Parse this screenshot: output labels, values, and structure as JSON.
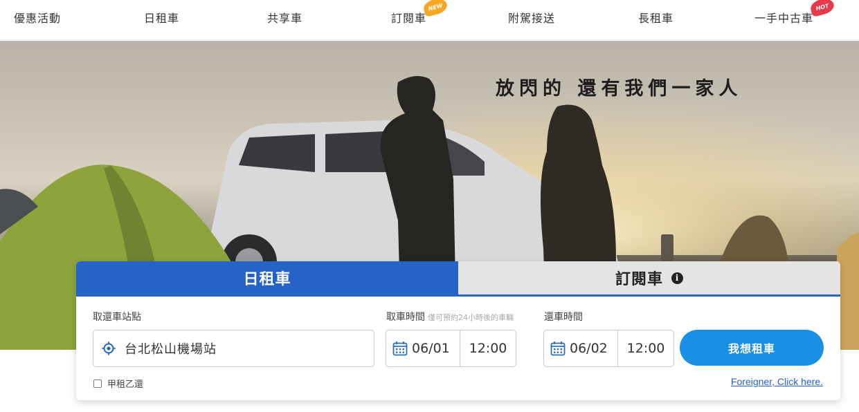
{
  "nav": {
    "items": [
      {
        "label": "優惠活動"
      },
      {
        "label": "日租車"
      },
      {
        "label": "共享車"
      },
      {
        "label": "訂閱車",
        "badge": "NEW"
      },
      {
        "label": "附駕接送"
      },
      {
        "label": "長租車"
      },
      {
        "label": "一手中古車",
        "badge": "HOT"
      }
    ]
  },
  "hero": {
    "slogan": "放閃的 還有我們一家人"
  },
  "booking": {
    "tabs": [
      {
        "label": "日租車",
        "active": true
      },
      {
        "label": "訂閱車",
        "active": false
      }
    ],
    "station": {
      "label": "取還車站點",
      "value": "台北松山機場站",
      "icon": "location-target-icon"
    },
    "pickup": {
      "label": "取車時間",
      "hint": "僅可預約24小時後的車輛",
      "date": "06/01",
      "time": "12:00",
      "icon": "calendar-icon"
    },
    "return": {
      "label": "還車時間",
      "date": "06/02",
      "time": "12:00",
      "icon": "calendar-icon"
    },
    "submit_label": "我想租車",
    "one_way_label": "甲租乙還",
    "one_way_checked": false,
    "foreigner_link": "Foreigner, Click here."
  },
  "colors": {
    "primary": "#2563c6",
    "button": "#1a8fe3",
    "badge_new": "#f5a623",
    "badge_hot": "#e8394b"
  }
}
